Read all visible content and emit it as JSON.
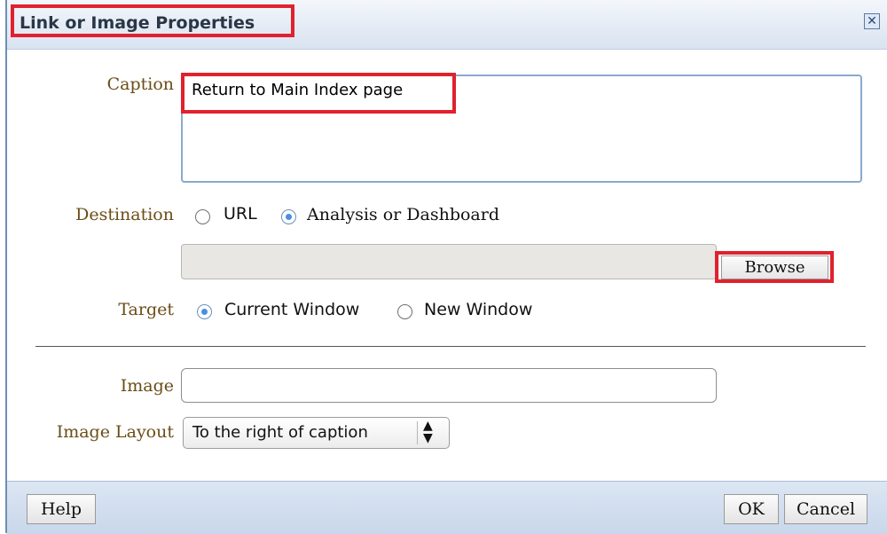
{
  "dialog": {
    "title": "Link or Image Properties",
    "close_icon": "close-icon"
  },
  "caption": {
    "label": "Caption",
    "value": "Return to Main Index page"
  },
  "destination": {
    "label": "Destination",
    "options": [
      {
        "label": "URL",
        "selected": false
      },
      {
        "label": "Analysis or Dashboard",
        "selected": true
      }
    ],
    "field_value": "",
    "browse_label": "Browse"
  },
  "target": {
    "label": "Target",
    "options": [
      {
        "label": "Current Window",
        "selected": true
      },
      {
        "label": "New Window",
        "selected": false
      }
    ]
  },
  "image": {
    "label": "Image",
    "value": ""
  },
  "image_layout": {
    "label": "Image Layout",
    "selected": "To the right of caption"
  },
  "footer": {
    "help_label": "Help",
    "ok_label": "OK",
    "cancel_label": "Cancel"
  },
  "colors": {
    "highlight": "#e0212e",
    "label_text": "#6b4d16",
    "radio_selected": "#4a8fe0"
  }
}
